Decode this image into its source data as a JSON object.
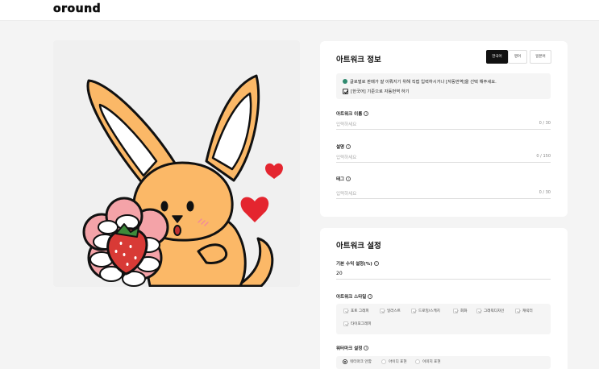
{
  "header": {
    "logo": "oround"
  },
  "artwork_info": {
    "title": "아트워크 정보",
    "languages": [
      "한국어",
      "영어",
      "일본어"
    ],
    "active_language": "한국어",
    "notice_text": "글로벌로 판매가 잘 이뤄지기 위해 직접 입력하시거나 [자동번역]을 선택 해주세요.",
    "auto_translate_label": "[한국어] 기준으로 자동번역 하기",
    "fields": [
      {
        "label": "아트워크 이름",
        "placeholder": "입력하세요",
        "count": "0 / 30"
      },
      {
        "label": "설명",
        "placeholder": "입력하세요",
        "count": "0 / 150"
      },
      {
        "label": "태그",
        "placeholder": "입력하세요",
        "count": "0 / 30"
      }
    ]
  },
  "artwork_settings": {
    "title": "아트워크 설정",
    "margin_label": "기본 수익 설정(%)",
    "margin_value": "20",
    "style_label": "아트워크 스타일",
    "styles": [
      "포토 그래피",
      "일러스트",
      "드로잉/스케치",
      "회화",
      "그래픽디자인",
      "캐릭터",
      "타이포그래피"
    ],
    "watermark_label": "워터마크 설정",
    "watermark_options": [
      "워터마크 안함",
      "아이디 표현",
      "이미지 표현"
    ],
    "watermark_selected": "워터마크 안함"
  },
  "colors": {
    "fox": "#fbb867",
    "heart": "#e4252f",
    "strawberry": "#d83a36",
    "flower": "#f4a3a8",
    "accent_dot": "#2f8a6f"
  }
}
